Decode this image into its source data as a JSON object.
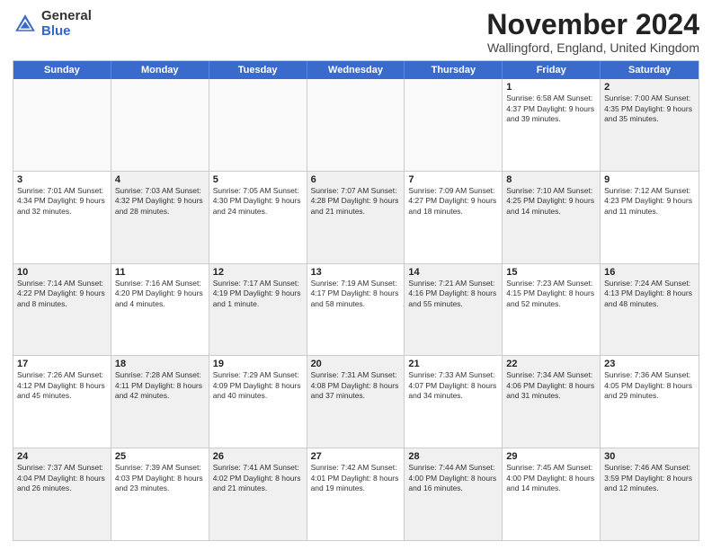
{
  "logo": {
    "general": "General",
    "blue": "Blue"
  },
  "title": "November 2024",
  "location": "Wallingford, England, United Kingdom",
  "header_days": [
    "Sunday",
    "Monday",
    "Tuesday",
    "Wednesday",
    "Thursday",
    "Friday",
    "Saturday"
  ],
  "weeks": [
    [
      {
        "day": "",
        "info": "",
        "shaded": false,
        "empty": true
      },
      {
        "day": "",
        "info": "",
        "shaded": false,
        "empty": true
      },
      {
        "day": "",
        "info": "",
        "shaded": false,
        "empty": true
      },
      {
        "day": "",
        "info": "",
        "shaded": false,
        "empty": true
      },
      {
        "day": "",
        "info": "",
        "shaded": false,
        "empty": true
      },
      {
        "day": "1",
        "info": "Sunrise: 6:58 AM\nSunset: 4:37 PM\nDaylight: 9 hours\nand 39 minutes.",
        "shaded": false,
        "empty": false
      },
      {
        "day": "2",
        "info": "Sunrise: 7:00 AM\nSunset: 4:35 PM\nDaylight: 9 hours\nand 35 minutes.",
        "shaded": true,
        "empty": false
      }
    ],
    [
      {
        "day": "3",
        "info": "Sunrise: 7:01 AM\nSunset: 4:34 PM\nDaylight: 9 hours\nand 32 minutes.",
        "shaded": false,
        "empty": false
      },
      {
        "day": "4",
        "info": "Sunrise: 7:03 AM\nSunset: 4:32 PM\nDaylight: 9 hours\nand 28 minutes.",
        "shaded": true,
        "empty": false
      },
      {
        "day": "5",
        "info": "Sunrise: 7:05 AM\nSunset: 4:30 PM\nDaylight: 9 hours\nand 24 minutes.",
        "shaded": false,
        "empty": false
      },
      {
        "day": "6",
        "info": "Sunrise: 7:07 AM\nSunset: 4:28 PM\nDaylight: 9 hours\nand 21 minutes.",
        "shaded": true,
        "empty": false
      },
      {
        "day": "7",
        "info": "Sunrise: 7:09 AM\nSunset: 4:27 PM\nDaylight: 9 hours\nand 18 minutes.",
        "shaded": false,
        "empty": false
      },
      {
        "day": "8",
        "info": "Sunrise: 7:10 AM\nSunset: 4:25 PM\nDaylight: 9 hours\nand 14 minutes.",
        "shaded": true,
        "empty": false
      },
      {
        "day": "9",
        "info": "Sunrise: 7:12 AM\nSunset: 4:23 PM\nDaylight: 9 hours\nand 11 minutes.",
        "shaded": false,
        "empty": false
      }
    ],
    [
      {
        "day": "10",
        "info": "Sunrise: 7:14 AM\nSunset: 4:22 PM\nDaylight: 9 hours\nand 8 minutes.",
        "shaded": true,
        "empty": false
      },
      {
        "day": "11",
        "info": "Sunrise: 7:16 AM\nSunset: 4:20 PM\nDaylight: 9 hours\nand 4 minutes.",
        "shaded": false,
        "empty": false
      },
      {
        "day": "12",
        "info": "Sunrise: 7:17 AM\nSunset: 4:19 PM\nDaylight: 9 hours\nand 1 minute.",
        "shaded": true,
        "empty": false
      },
      {
        "day": "13",
        "info": "Sunrise: 7:19 AM\nSunset: 4:17 PM\nDaylight: 8 hours\nand 58 minutes.",
        "shaded": false,
        "empty": false
      },
      {
        "day": "14",
        "info": "Sunrise: 7:21 AM\nSunset: 4:16 PM\nDaylight: 8 hours\nand 55 minutes.",
        "shaded": true,
        "empty": false
      },
      {
        "day": "15",
        "info": "Sunrise: 7:23 AM\nSunset: 4:15 PM\nDaylight: 8 hours\nand 52 minutes.",
        "shaded": false,
        "empty": false
      },
      {
        "day": "16",
        "info": "Sunrise: 7:24 AM\nSunset: 4:13 PM\nDaylight: 8 hours\nand 48 minutes.",
        "shaded": true,
        "empty": false
      }
    ],
    [
      {
        "day": "17",
        "info": "Sunrise: 7:26 AM\nSunset: 4:12 PM\nDaylight: 8 hours\nand 45 minutes.",
        "shaded": false,
        "empty": false
      },
      {
        "day": "18",
        "info": "Sunrise: 7:28 AM\nSunset: 4:11 PM\nDaylight: 8 hours\nand 42 minutes.",
        "shaded": true,
        "empty": false
      },
      {
        "day": "19",
        "info": "Sunrise: 7:29 AM\nSunset: 4:09 PM\nDaylight: 8 hours\nand 40 minutes.",
        "shaded": false,
        "empty": false
      },
      {
        "day": "20",
        "info": "Sunrise: 7:31 AM\nSunset: 4:08 PM\nDaylight: 8 hours\nand 37 minutes.",
        "shaded": true,
        "empty": false
      },
      {
        "day": "21",
        "info": "Sunrise: 7:33 AM\nSunset: 4:07 PM\nDaylight: 8 hours\nand 34 minutes.",
        "shaded": false,
        "empty": false
      },
      {
        "day": "22",
        "info": "Sunrise: 7:34 AM\nSunset: 4:06 PM\nDaylight: 8 hours\nand 31 minutes.",
        "shaded": true,
        "empty": false
      },
      {
        "day": "23",
        "info": "Sunrise: 7:36 AM\nSunset: 4:05 PM\nDaylight: 8 hours\nand 29 minutes.",
        "shaded": false,
        "empty": false
      }
    ],
    [
      {
        "day": "24",
        "info": "Sunrise: 7:37 AM\nSunset: 4:04 PM\nDaylight: 8 hours\nand 26 minutes.",
        "shaded": true,
        "empty": false
      },
      {
        "day": "25",
        "info": "Sunrise: 7:39 AM\nSunset: 4:03 PM\nDaylight: 8 hours\nand 23 minutes.",
        "shaded": false,
        "empty": false
      },
      {
        "day": "26",
        "info": "Sunrise: 7:41 AM\nSunset: 4:02 PM\nDaylight: 8 hours\nand 21 minutes.",
        "shaded": true,
        "empty": false
      },
      {
        "day": "27",
        "info": "Sunrise: 7:42 AM\nSunset: 4:01 PM\nDaylight: 8 hours\nand 19 minutes.",
        "shaded": false,
        "empty": false
      },
      {
        "day": "28",
        "info": "Sunrise: 7:44 AM\nSunset: 4:00 PM\nDaylight: 8 hours\nand 16 minutes.",
        "shaded": true,
        "empty": false
      },
      {
        "day": "29",
        "info": "Sunrise: 7:45 AM\nSunset: 4:00 PM\nDaylight: 8 hours\nand 14 minutes.",
        "shaded": false,
        "empty": false
      },
      {
        "day": "30",
        "info": "Sunrise: 7:46 AM\nSunset: 3:59 PM\nDaylight: 8 hours\nand 12 minutes.",
        "shaded": true,
        "empty": false
      }
    ]
  ]
}
